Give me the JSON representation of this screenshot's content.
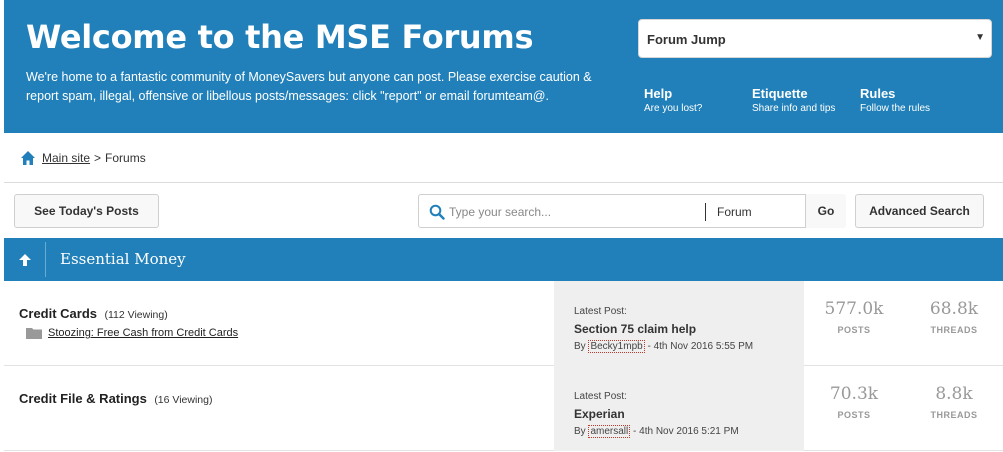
{
  "header": {
    "title": "Welcome to the MSE Forums",
    "description": "We're home to a fantastic community of MoneySavers but anyone can post. Please exercise caution & report spam, illegal, offensive or libellous posts/messages: click \"report\" or email forumteam@.",
    "forum_jump": {
      "label": "Forum Jump",
      "icon": "chevron-down-icon"
    },
    "links": [
      {
        "title": "Help",
        "subtitle": "Are you lost?"
      },
      {
        "title": "Etiquette",
        "subtitle": "Share info and tips"
      },
      {
        "title": "Rules",
        "subtitle": "Follow the rules"
      }
    ],
    "color": "#2180b9"
  },
  "breadcrumb": {
    "home": "Main site",
    "separator": ">",
    "current": "Forums",
    "icon": "home-icon"
  },
  "toolbar": {
    "todays_posts": "See Today's Posts",
    "search_placeholder": "Type your search...",
    "search_scope": "Forum",
    "go": "Go",
    "advanced_search": "Advanced Search"
  },
  "section": {
    "title": "Essential Money",
    "icon": "arrow-up-icon"
  },
  "forums": [
    {
      "title": "Credit Cards",
      "viewing": "(112 Viewing)",
      "subforum": "Stoozing: Free Cash from Credit Cards",
      "latest_label": "Latest Post:",
      "latest_title": "Section 75 claim help",
      "by_prefix": "By",
      "latest_user": "Becky1mpb",
      "latest_date": "- 4th Nov 2016 5:55 PM",
      "posts": "577.0k",
      "posts_label": "POSTS",
      "threads": "68.8k",
      "threads_label": "THREADS"
    },
    {
      "title": "Credit File & Ratings",
      "viewing": "(16 Viewing)",
      "latest_label": "Latest Post:",
      "latest_title": "Experian",
      "by_prefix": "By",
      "latest_user": "amersall",
      "latest_date": "- 4th Nov 2016 5:21 PM",
      "posts": "70.3k",
      "posts_label": "POSTS",
      "threads": "8.8k",
      "threads_label": "THREADS"
    }
  ]
}
